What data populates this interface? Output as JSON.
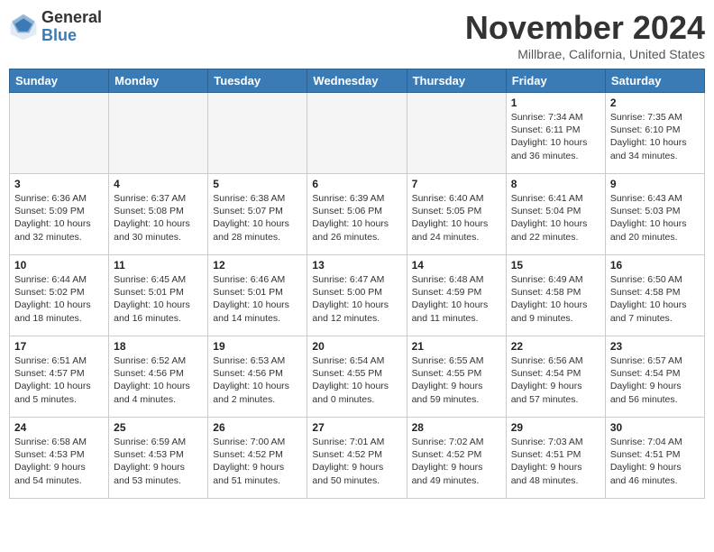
{
  "header": {
    "logo_general": "General",
    "logo_blue": "Blue",
    "month_title": "November 2024",
    "location": "Millbrae, California, United States"
  },
  "days_of_week": [
    "Sunday",
    "Monday",
    "Tuesday",
    "Wednesday",
    "Thursday",
    "Friday",
    "Saturday"
  ],
  "weeks": [
    [
      {
        "day": "",
        "info": ""
      },
      {
        "day": "",
        "info": ""
      },
      {
        "day": "",
        "info": ""
      },
      {
        "day": "",
        "info": ""
      },
      {
        "day": "",
        "info": ""
      },
      {
        "day": "1",
        "info": "Sunrise: 7:34 AM\nSunset: 6:11 PM\nDaylight: 10 hours and 36 minutes."
      },
      {
        "day": "2",
        "info": "Sunrise: 7:35 AM\nSunset: 6:10 PM\nDaylight: 10 hours and 34 minutes."
      }
    ],
    [
      {
        "day": "3",
        "info": "Sunrise: 6:36 AM\nSunset: 5:09 PM\nDaylight: 10 hours and 32 minutes."
      },
      {
        "day": "4",
        "info": "Sunrise: 6:37 AM\nSunset: 5:08 PM\nDaylight: 10 hours and 30 minutes."
      },
      {
        "day": "5",
        "info": "Sunrise: 6:38 AM\nSunset: 5:07 PM\nDaylight: 10 hours and 28 minutes."
      },
      {
        "day": "6",
        "info": "Sunrise: 6:39 AM\nSunset: 5:06 PM\nDaylight: 10 hours and 26 minutes."
      },
      {
        "day": "7",
        "info": "Sunrise: 6:40 AM\nSunset: 5:05 PM\nDaylight: 10 hours and 24 minutes."
      },
      {
        "day": "8",
        "info": "Sunrise: 6:41 AM\nSunset: 5:04 PM\nDaylight: 10 hours and 22 minutes."
      },
      {
        "day": "9",
        "info": "Sunrise: 6:43 AM\nSunset: 5:03 PM\nDaylight: 10 hours and 20 minutes."
      }
    ],
    [
      {
        "day": "10",
        "info": "Sunrise: 6:44 AM\nSunset: 5:02 PM\nDaylight: 10 hours and 18 minutes."
      },
      {
        "day": "11",
        "info": "Sunrise: 6:45 AM\nSunset: 5:01 PM\nDaylight: 10 hours and 16 minutes."
      },
      {
        "day": "12",
        "info": "Sunrise: 6:46 AM\nSunset: 5:01 PM\nDaylight: 10 hours and 14 minutes."
      },
      {
        "day": "13",
        "info": "Sunrise: 6:47 AM\nSunset: 5:00 PM\nDaylight: 10 hours and 12 minutes."
      },
      {
        "day": "14",
        "info": "Sunrise: 6:48 AM\nSunset: 4:59 PM\nDaylight: 10 hours and 11 minutes."
      },
      {
        "day": "15",
        "info": "Sunrise: 6:49 AM\nSunset: 4:58 PM\nDaylight: 10 hours and 9 minutes."
      },
      {
        "day": "16",
        "info": "Sunrise: 6:50 AM\nSunset: 4:58 PM\nDaylight: 10 hours and 7 minutes."
      }
    ],
    [
      {
        "day": "17",
        "info": "Sunrise: 6:51 AM\nSunset: 4:57 PM\nDaylight: 10 hours and 5 minutes."
      },
      {
        "day": "18",
        "info": "Sunrise: 6:52 AM\nSunset: 4:56 PM\nDaylight: 10 hours and 4 minutes."
      },
      {
        "day": "19",
        "info": "Sunrise: 6:53 AM\nSunset: 4:56 PM\nDaylight: 10 hours and 2 minutes."
      },
      {
        "day": "20",
        "info": "Sunrise: 6:54 AM\nSunset: 4:55 PM\nDaylight: 10 hours and 0 minutes."
      },
      {
        "day": "21",
        "info": "Sunrise: 6:55 AM\nSunset: 4:55 PM\nDaylight: 9 hours and 59 minutes."
      },
      {
        "day": "22",
        "info": "Sunrise: 6:56 AM\nSunset: 4:54 PM\nDaylight: 9 hours and 57 minutes."
      },
      {
        "day": "23",
        "info": "Sunrise: 6:57 AM\nSunset: 4:54 PM\nDaylight: 9 hours and 56 minutes."
      }
    ],
    [
      {
        "day": "24",
        "info": "Sunrise: 6:58 AM\nSunset: 4:53 PM\nDaylight: 9 hours and 54 minutes."
      },
      {
        "day": "25",
        "info": "Sunrise: 6:59 AM\nSunset: 4:53 PM\nDaylight: 9 hours and 53 minutes."
      },
      {
        "day": "26",
        "info": "Sunrise: 7:00 AM\nSunset: 4:52 PM\nDaylight: 9 hours and 51 minutes."
      },
      {
        "day": "27",
        "info": "Sunrise: 7:01 AM\nSunset: 4:52 PM\nDaylight: 9 hours and 50 minutes."
      },
      {
        "day": "28",
        "info": "Sunrise: 7:02 AM\nSunset: 4:52 PM\nDaylight: 9 hours and 49 minutes."
      },
      {
        "day": "29",
        "info": "Sunrise: 7:03 AM\nSunset: 4:51 PM\nDaylight: 9 hours and 48 minutes."
      },
      {
        "day": "30",
        "info": "Sunrise: 7:04 AM\nSunset: 4:51 PM\nDaylight: 9 hours and 46 minutes."
      }
    ]
  ]
}
